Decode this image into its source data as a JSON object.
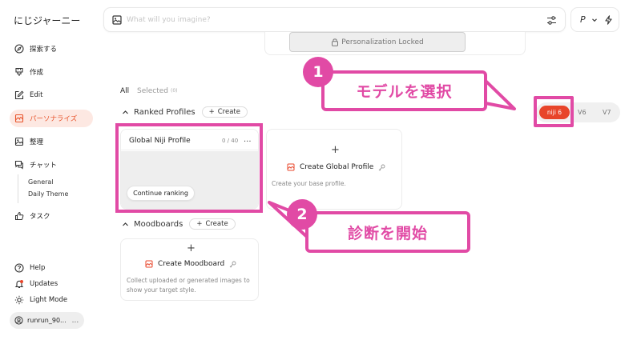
{
  "brand": "にじジャーニー",
  "sidebar": {
    "items": [
      {
        "label": "探索する",
        "icon": "compass-icon"
      },
      {
        "label": "作成",
        "icon": "brush-icon"
      },
      {
        "label": "Edit",
        "icon": "edit-icon"
      },
      {
        "label": "パーソナライズ",
        "icon": "personalize-icon",
        "active": true
      },
      {
        "label": "整理",
        "icon": "image-icon"
      },
      {
        "label": "チャット",
        "icon": "chat-icon"
      },
      {
        "label": "タスク",
        "icon": "thumbs-up-icon"
      }
    ],
    "chat_sub": [
      "General",
      "Daily Theme"
    ],
    "bottom": [
      {
        "label": "Help",
        "icon": "help-icon"
      },
      {
        "label": "Updates",
        "icon": "bell-icon"
      },
      {
        "label": "Light Mode",
        "icon": "sun-icon"
      }
    ],
    "user": "runrun_90...",
    "user_more": "..."
  },
  "search": {
    "placeholder": "What will you imagine?"
  },
  "profile_menu": {
    "label": "P"
  },
  "personalization": {
    "locked_label": "Personalization Locked"
  },
  "tabs": {
    "all": "All",
    "selected": "Selected",
    "selected_count": "(0)"
  },
  "ranked": {
    "title": "Ranked Profiles",
    "create": "Create",
    "global_card": {
      "title": "Global Niji Profile",
      "count": "0 / 40",
      "more": "...",
      "button": "Continue ranking"
    },
    "create_card": {
      "plus": "+",
      "title": "Create Global Profile",
      "desc": "Create your base profile."
    }
  },
  "moodboards": {
    "title": "Moodboards",
    "create": "Create",
    "create_card": {
      "plus": "+",
      "title": "Create Moodboard",
      "desc": "Collect uploaded or generated images to show your target style."
    }
  },
  "versions": [
    "niji 6",
    "V6",
    "V7"
  ],
  "annotations": {
    "step1": {
      "number": "1",
      "text": "モデルを選択"
    },
    "step2": {
      "number": "2",
      "text": "診断を開始"
    }
  },
  "colors": {
    "accent": "#e8452a",
    "annotation": "#e14aa5",
    "active_bg": "#fde8e2"
  }
}
